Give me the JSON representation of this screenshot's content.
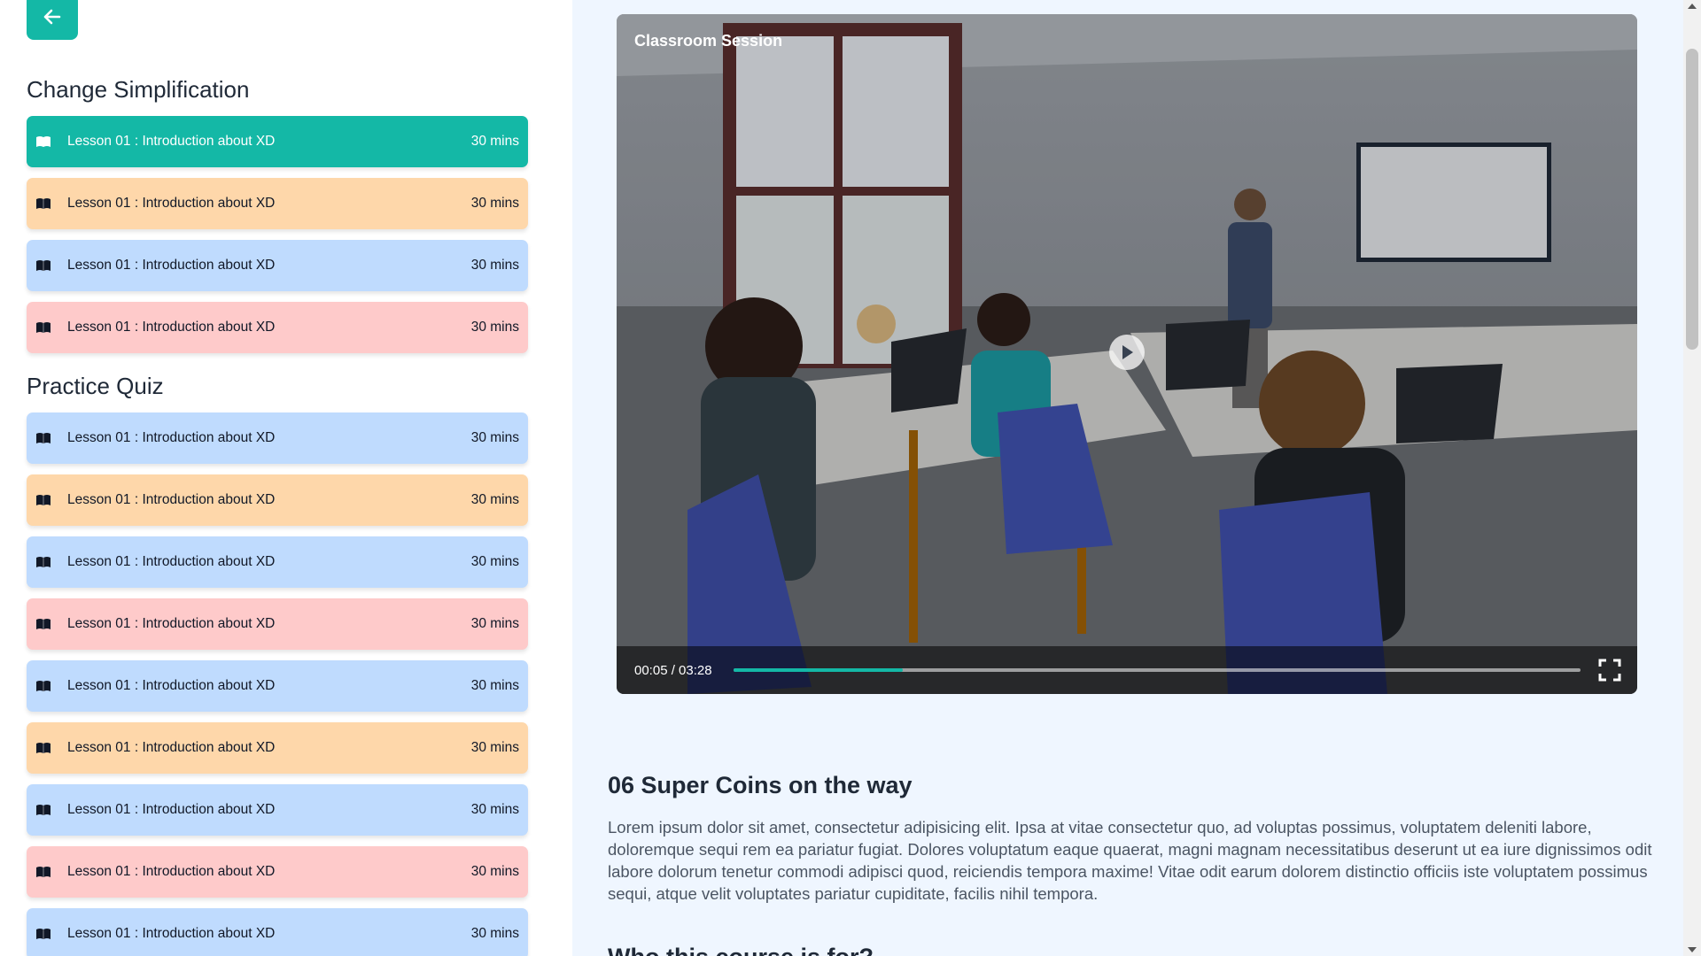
{
  "sidebar": {
    "sections": [
      {
        "title": "Change Simplification",
        "lessons": [
          {
            "label": "Lesson 01 : Introduction about XD",
            "duration": "30 mins",
            "color": "#14b8a6",
            "active": true
          },
          {
            "label": "Lesson 01 : Introduction about XD",
            "duration": "30 mins",
            "color": "#fed7aa"
          },
          {
            "label": "Lesson 01 : Introduction about XD",
            "duration": "30 mins",
            "color": "#bfdbfe"
          },
          {
            "label": "Lesson 01 : Introduction about XD",
            "duration": "30 mins",
            "color": "#fecaca"
          }
        ]
      },
      {
        "title": "Practice Quiz",
        "lessons": [
          {
            "label": "Lesson 01 : Introduction about XD",
            "duration": "30 mins",
            "color": "#bfdbfe"
          },
          {
            "label": "Lesson 01 : Introduction about XD",
            "duration": "30 mins",
            "color": "#fed7aa"
          },
          {
            "label": "Lesson 01 : Introduction about XD",
            "duration": "30 mins",
            "color": "#bfdbfe"
          },
          {
            "label": "Lesson 01 : Introduction about XD",
            "duration": "30 mins",
            "color": "#fecaca"
          },
          {
            "label": "Lesson 01 : Introduction about XD",
            "duration": "30 mins",
            "color": "#bfdbfe"
          },
          {
            "label": "Lesson 01 : Introduction about XD",
            "duration": "30 mins",
            "color": "#fed7aa"
          },
          {
            "label": "Lesson 01 : Introduction about XD",
            "duration": "30 mins",
            "color": "#bfdbfe"
          },
          {
            "label": "Lesson 01 : Introduction about XD",
            "duration": "30 mins",
            "color": "#fecaca"
          },
          {
            "label": "Lesson 01 : Introduction about XD",
            "duration": "30 mins",
            "color": "#bfdbfe"
          }
        ]
      }
    ]
  },
  "video": {
    "title": "Classroom Session",
    "time": "00:05 / 03:28",
    "progress": 0.2
  },
  "content": {
    "heading": "06 Super Coins on the way",
    "paragraph": "Lorem ipsum dolor sit amet, consectetur adipisicing elit. Ipsa at vitae consectetur quo, ad voluptas possimus, voluptatem deleniti labore, doloremque sequi rem ea pariatur fugiat. Dolores voluptatum eaque quaerat, magni magnam necessitatibus deserunt ut ea iure dignissimos odit labore dolorum tenetur commodi adipisci quod, reiciendis tempora maxime! Vitae odit earum dolorem distinctio officiis iste voluptatem possimus sequi, atque velit voluptates pariatur cupiditate, facilis nihil tempora.",
    "heading2": "Who this course is for?"
  },
  "icons": {
    "back": "arrow-left-icon",
    "lesson": "book-open-icon",
    "play": "play-icon",
    "fullscreen": "fullscreen-icon"
  },
  "colors": {
    "accent": "#14b8a6",
    "orange": "#fed7aa",
    "blue": "#bfdbfe",
    "pink": "#fecaca",
    "main_bg": "#eff6ff"
  }
}
